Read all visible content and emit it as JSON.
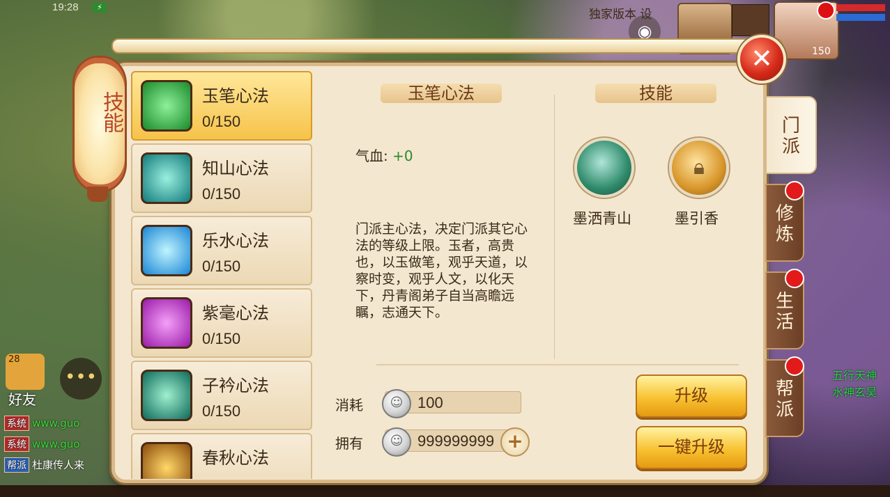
{
  "hud": {
    "time": "19:28",
    "promo_text": "独家版本 设",
    "player_level": "150"
  },
  "friends": {
    "level": "28",
    "label": "好友"
  },
  "chat": [
    {
      "tag": "系统",
      "text": "www.guo"
    },
    {
      "tag": "系统",
      "text": "www.guo"
    },
    {
      "tag": "帮派",
      "text": "杜康传人来"
    }
  ],
  "side_names": [
    "五行天神",
    "水神玄昊"
  ],
  "panel": {
    "lantern_title": "技能",
    "close_label": "✕"
  },
  "skill_list": [
    {
      "name": "玉笔心法",
      "level": "0/150",
      "selected": true,
      "icon": "jade-brush-icon",
      "color": "#2a9a3a"
    },
    {
      "name": "知山心法",
      "level": "0/150",
      "selected": false,
      "icon": "mountain-icon",
      "color": "#1a8a8a"
    },
    {
      "name": "乐水心法",
      "level": "0/150",
      "selected": false,
      "icon": "water-swirl-icon",
      "color": "#2a9ae0"
    },
    {
      "name": "紫毫心法",
      "level": "0/150",
      "selected": false,
      "icon": "purple-brush-icon",
      "color": "#b02ab8"
    },
    {
      "name": "子衿心法",
      "level": "0/150",
      "selected": false,
      "icon": "ribbon-brush-icon",
      "color": "#1a7a6a"
    },
    {
      "name": "春秋心法",
      "level": "",
      "selected": false,
      "icon": "spring-autumn-icon",
      "color": "#b87a1a"
    }
  ],
  "detail": {
    "title": "玉笔心法",
    "stat_label": "气血: ",
    "stat_value": "+0",
    "description": "门派主心法，决定门派其它心法的等级上限。玉者，高贵也，以玉做笔，观乎天道，以察时变，观乎人文，以化天下，丹青阁弟子自当高瞻远瞩，志通天下。"
  },
  "skills": {
    "header": "技能",
    "items": [
      {
        "name": "墨洒青山",
        "icon": "ink-brush-icon",
        "locked": false
      },
      {
        "name": "墨引香",
        "icon": "lock-icon",
        "locked": true
      }
    ]
  },
  "cost": {
    "consume_label": "消耗",
    "consume_value": "100",
    "own_label": "拥有",
    "own_value": "999999999"
  },
  "buttons": {
    "upgrade": "升级",
    "upgrade_all": "一键升级"
  },
  "tabs": [
    {
      "label": "门派",
      "active": true,
      "dot": false
    },
    {
      "label": "修炼",
      "active": false,
      "dot": true
    },
    {
      "label": "生活",
      "active": false,
      "dot": true
    },
    {
      "label": "帮派",
      "active": false,
      "dot": true
    }
  ]
}
